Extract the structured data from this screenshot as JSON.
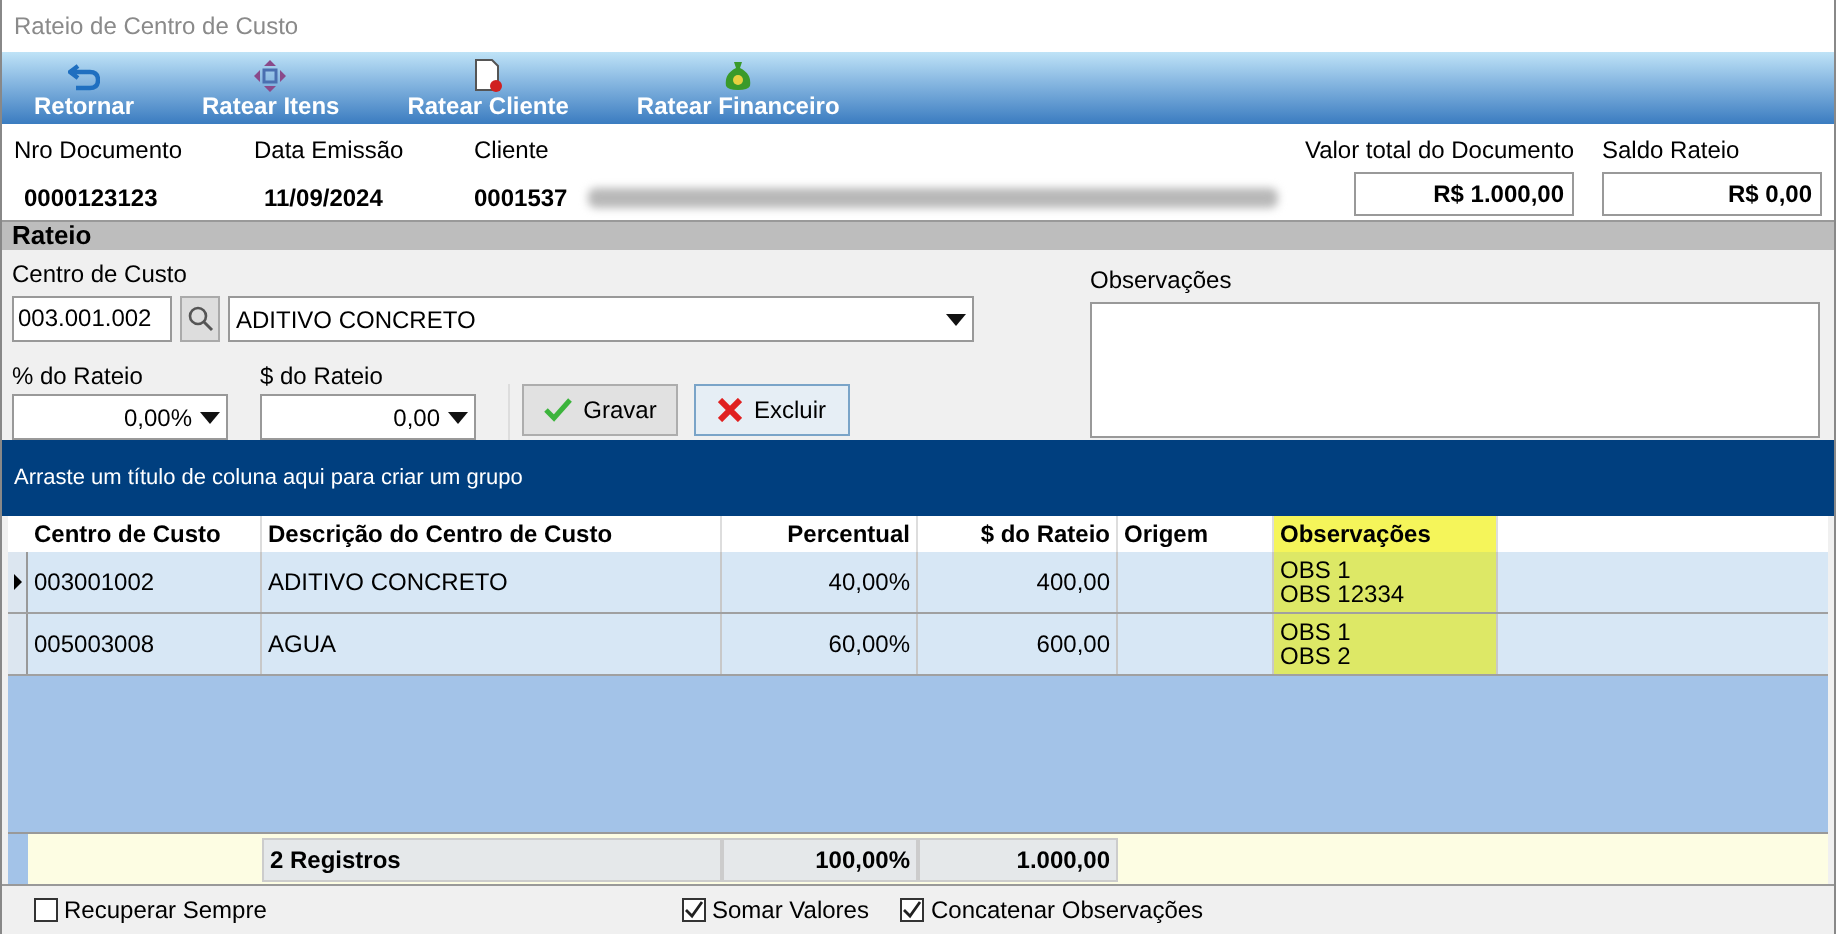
{
  "window": {
    "title": "Rateio de Centro de Custo"
  },
  "toolbar": [
    {
      "label": "Retornar"
    },
    {
      "label": "Ratear Itens"
    },
    {
      "label": "Ratear Cliente"
    },
    {
      "label": "Ratear Financeiro"
    }
  ],
  "header": {
    "documento_label": "Nro Documento",
    "documento": "0000123123",
    "data_label": "Data Emissão",
    "data": "11/09/2024",
    "cliente_label": "Cliente",
    "cliente": "0001537",
    "valor_label": "Valor total do Documento",
    "valor": "R$ 1.000,00",
    "saldo_label": "Saldo Rateio",
    "saldo": "R$ 0,00"
  },
  "section_title": "Rateio",
  "form": {
    "centro_label": "Centro de Custo",
    "centro_code": "003.001.002",
    "centro_name": "ADITIVO CONCRETO",
    "percent_label": "% do Rateio",
    "percent": "0,00%",
    "amount_label": "$ do Rateio",
    "amount": "0,00",
    "observacoes_label": "Observações",
    "buttons": [
      {
        "label": "Gravar",
        "kind": "save"
      },
      {
        "label": "Excluir",
        "kind": "delete"
      }
    ]
  },
  "grid": {
    "group_hint": "Arraste um título de coluna aqui para criar um grupo",
    "columns": [
      {
        "label": "Centro de Custo",
        "kind": "text",
        "highlighted": false
      },
      {
        "label": "Descrição do Centro de Custo",
        "kind": "text",
        "highlighted": false
      },
      {
        "label": "Percentual",
        "kind": "number",
        "highlighted": false
      },
      {
        "label": "$ do Rateio",
        "kind": "number",
        "highlighted": false
      },
      {
        "label": "Origem",
        "kind": "text",
        "highlighted": false
      },
      {
        "label": "Observações",
        "kind": "text",
        "highlighted": true
      }
    ],
    "rows": [
      {
        "selected": true,
        "cells": [
          "003001002",
          "ADITIVO CONCRETO",
          "40,00%",
          "400,00",
          "",
          [
            "OBS 1",
            "OBS 12334"
          ]
        ]
      },
      {
        "selected": false,
        "cells": [
          "005003008",
          "AGUA",
          "60,00%",
          "600,00",
          "",
          [
            "OBS 1",
            "OBS 2"
          ]
        ]
      }
    ],
    "footer": [
      "2 Registros",
      "100,00%",
      "1.000,00"
    ]
  },
  "options": [
    {
      "label": "Recuperar Sempre",
      "checked": false
    },
    {
      "label": "Somar Valores",
      "checked": true
    },
    {
      "label": "Concatenar Observações",
      "checked": true
    }
  ]
}
